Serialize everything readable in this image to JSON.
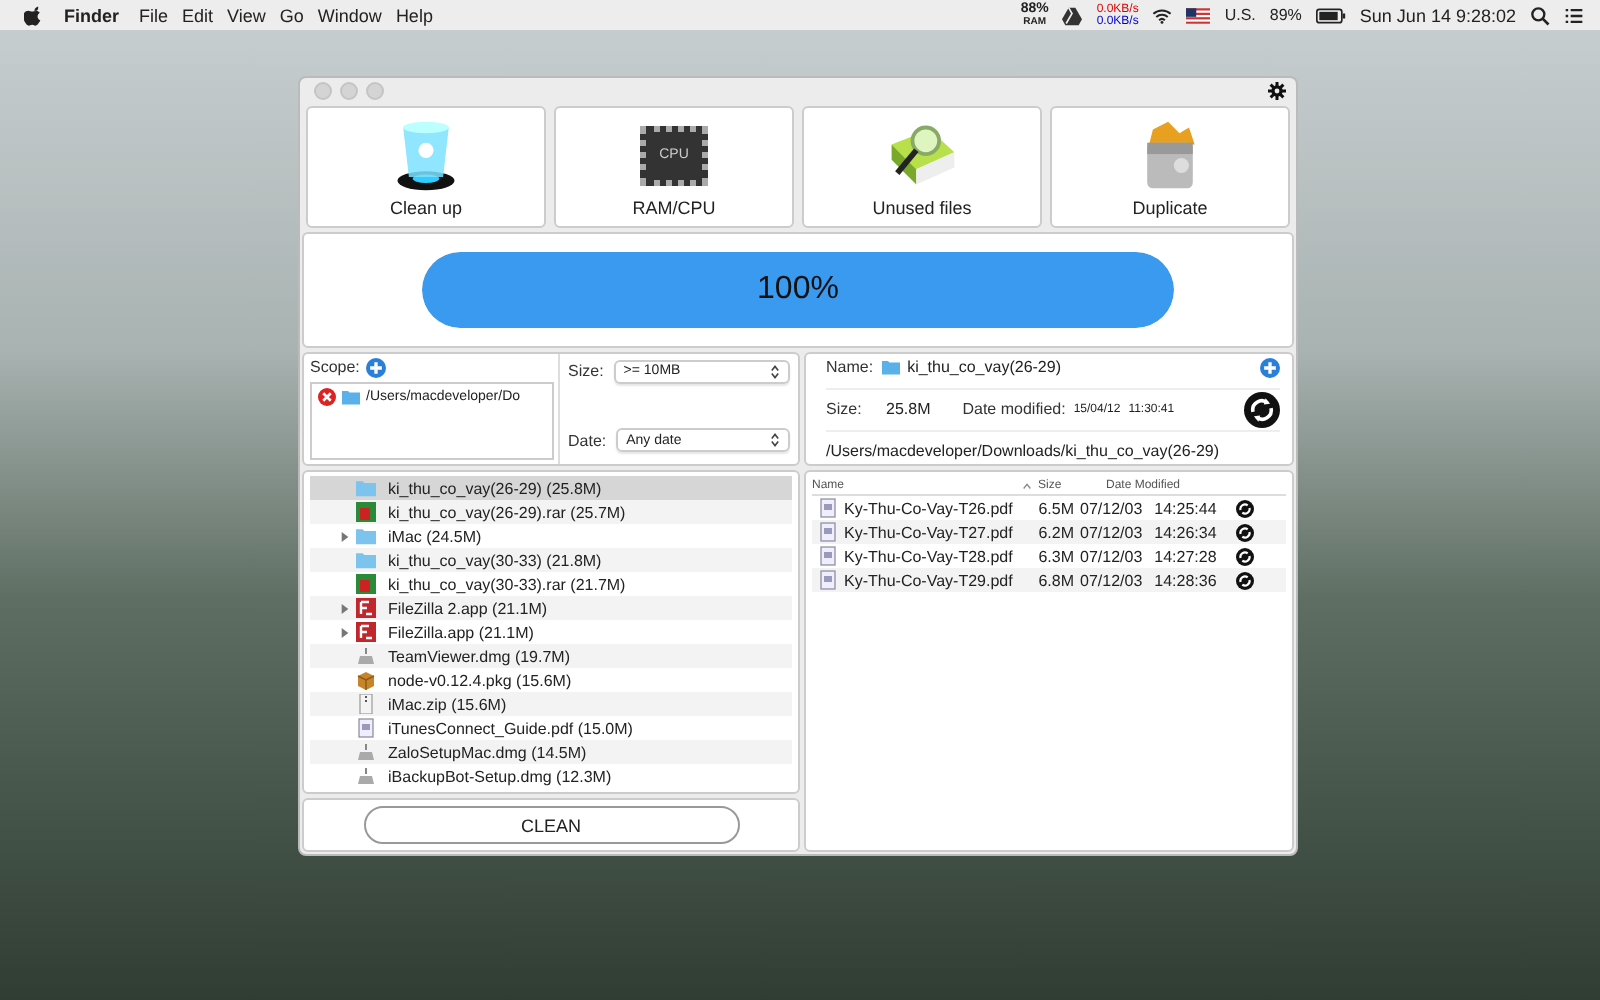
{
  "menu_bar": {
    "app": "Finder",
    "items": [
      "File",
      "Edit",
      "View",
      "Go",
      "Window",
      "Help"
    ],
    "ram_value": "88%",
    "ram_label": "RAM",
    "net_up": "0.0KB/s",
    "net_down": "0.0KB/s",
    "input_source": "U.S.",
    "battery": "89%",
    "clock": "Sun Jun 14 9:28:02"
  },
  "tools": [
    {
      "kind": "cleanup",
      "label": "Clean up"
    },
    {
      "kind": "cpu",
      "label": "RAM/CPU",
      "icon_text": "CPU"
    },
    {
      "kind": "book",
      "label": "Unused files"
    },
    {
      "kind": "shredder",
      "label": "Duplicate"
    }
  ],
  "progress": {
    "level": 1,
    "text": "100%"
  },
  "scope": {
    "label": "Scope:",
    "paths": [
      "/Users/macdeveloper/Do"
    ]
  },
  "filters": [
    {
      "label": "Size:",
      "value": ">= 10MB"
    },
    {
      "label": "Date:",
      "value": "Any date"
    }
  ],
  "details": {
    "name_label": "Name:",
    "name": "ki_thu_co_vay(26-29)",
    "size_label": "Size:",
    "size": "25.8M",
    "date_label": "Date modified:",
    "date": "15/04/12",
    "time": "11:30:41",
    "path": "/Users/macdeveloper/Downloads/ki_thu_co_vay(26-29)"
  },
  "results": [
    {
      "kind": "folder",
      "label": "ki_thu_co_vay(26-29) (25.8M)",
      "selected": true,
      "expandable": false
    },
    {
      "kind": "rar",
      "label": "ki_thu_co_vay(26-29).rar (25.7M)",
      "selected": false,
      "expandable": false
    },
    {
      "kind": "folder",
      "label": "iMac (24.5M)",
      "selected": false,
      "expandable": true
    },
    {
      "kind": "folder",
      "label": "ki_thu_co_vay(30-33) (21.8M)",
      "selected": false,
      "expandable": false
    },
    {
      "kind": "rar",
      "label": "ki_thu_co_vay(30-33).rar (21.7M)",
      "selected": false,
      "expandable": false
    },
    {
      "kind": "app",
      "label": "FileZilla 2.app (21.1M)",
      "selected": false,
      "expandable": true
    },
    {
      "kind": "app",
      "label": "FileZilla.app (21.1M)",
      "selected": false,
      "expandable": true
    },
    {
      "kind": "dmg",
      "label": "TeamViewer.dmg (19.7M)",
      "selected": false,
      "expandable": false
    },
    {
      "kind": "pkg",
      "label": "node-v0.12.4.pkg (15.6M)",
      "selected": false,
      "expandable": false
    },
    {
      "kind": "zip",
      "label": "iMac.zip (15.6M)",
      "selected": false,
      "expandable": false
    },
    {
      "kind": "pdf",
      "label": "iTunesConnect_Guide.pdf (15.0M)",
      "selected": false,
      "expandable": false
    },
    {
      "kind": "dmg",
      "label": "ZaloSetupMac.dmg (14.5M)",
      "selected": false,
      "expandable": false
    },
    {
      "kind": "dmg",
      "label": "iBackupBot-Setup.dmg (12.3M)",
      "selected": false,
      "expandable": false
    }
  ],
  "clean_button": "CLEAN",
  "files": {
    "columns": [
      "Name",
      "Size",
      "Date Modified"
    ],
    "rows": [
      {
        "name": "Ky-Thu-Co-Vay-T26.pdf",
        "size": "6.5M",
        "date": "07/12/03",
        "time": "14:25:44"
      },
      {
        "name": "Ky-Thu-Co-Vay-T27.pdf",
        "size": "6.2M",
        "date": "07/12/03",
        "time": "14:26:34"
      },
      {
        "name": "Ky-Thu-Co-Vay-T28.pdf",
        "size": "6.3M",
        "date": "07/12/03",
        "time": "14:27:28"
      },
      {
        "name": "Ky-Thu-Co-Vay-T29.pdf",
        "size": "6.8M",
        "date": "07/12/03",
        "time": "14:28:36"
      }
    ]
  }
}
